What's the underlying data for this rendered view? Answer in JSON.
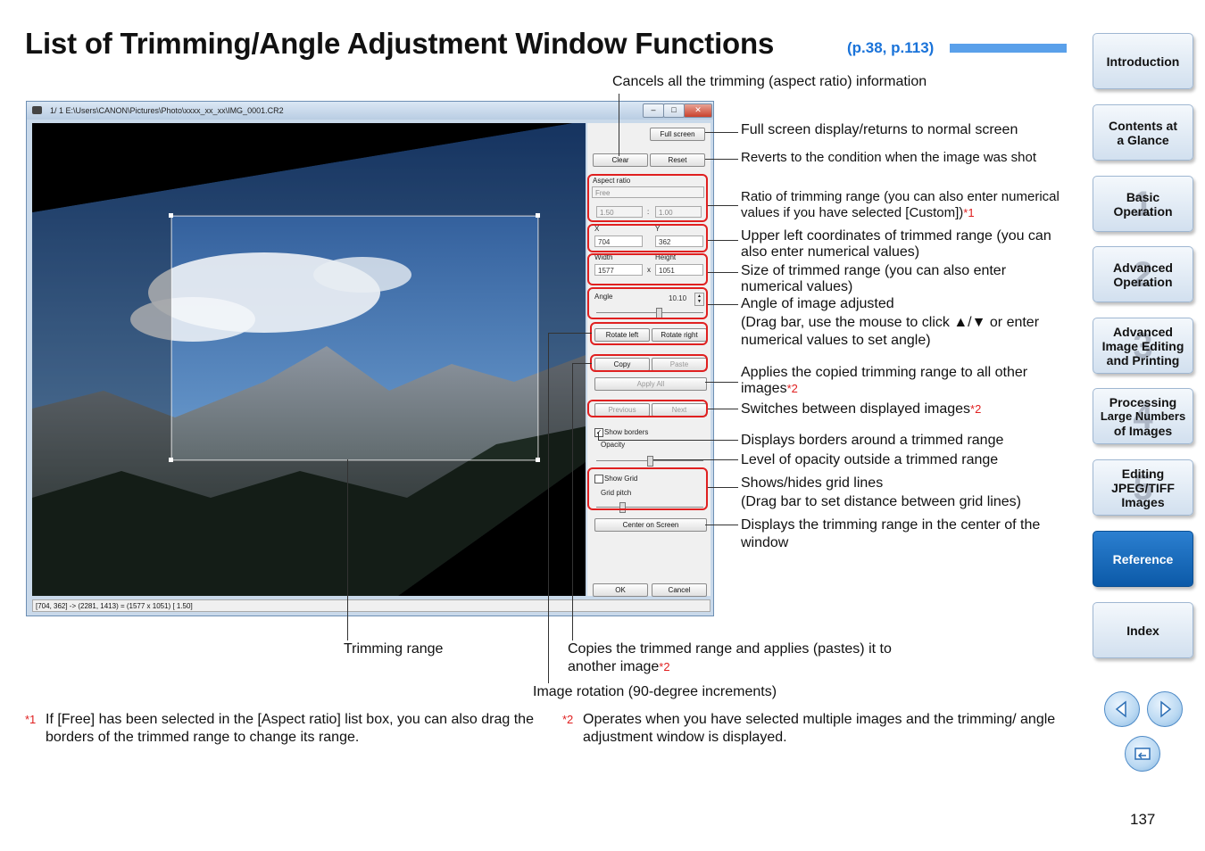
{
  "title": "List of Trimming/Angle Adjustment Window Functions",
  "title_ref": "(p.38, p.113)",
  "window": {
    "titlebar": "1/ 1  E:\\Users\\CANON\\Pictures\\Photo\\xxxx_xx_xx\\IMG_0001.CR2",
    "buttons": {
      "full_screen": "Full screen",
      "clear": "Clear",
      "reset": "Reset",
      "rotate_left": "Rotate left",
      "rotate_right": "Rotate right",
      "copy": "Copy",
      "paste": "Paste",
      "apply_all": "Apply All",
      "previous": "Previous",
      "next": "Next",
      "center_on_screen": "Center on Screen",
      "ok": "OK",
      "cancel": "Cancel"
    },
    "aspect_ratio_label": "Aspect ratio",
    "aspect_ratio_value": "Free",
    "ratio_a": "1.50",
    "ratio_sep": ":",
    "ratio_b": "1.00",
    "x_label": "X",
    "x_value": "704",
    "y_label": "Y",
    "y_value": "362",
    "width_label": "Width",
    "width_value": "1577",
    "times": "x",
    "height_label": "Height",
    "height_value": "1051",
    "angle_label": "Angle",
    "angle_value": "10.10",
    "show_borders": "Show borders",
    "opacity_label": "Opacity",
    "show_grid": "Show Grid",
    "grid_pitch": "Grid pitch",
    "status": "[704,  362] -> (2281, 1413) = (1577 x 1051) [ 1.50]"
  },
  "callouts": {
    "cancels": "Cancels all the trimming (aspect ratio) information",
    "full_screen": "Full screen display/returns to normal screen",
    "reverts": "Reverts to the condition when the image was shot",
    "ratio": "Ratio of trimming range (you can also enter numerical values if you have selected [Custom])",
    "ratio_mark": "*1",
    "upper_left": "Upper left coordinates of trimmed range (you can also enter numerical values)",
    "size": "Size of trimmed range (you can also enter numerical values)",
    "angle": "Angle of image adjusted",
    "angle_sub": "(Drag bar, use the mouse to click ▲/▼ or enter numerical values to set angle)",
    "applies": "Applies the copied trimming range to all other images",
    "applies_mark": "*2",
    "switches": "Switches between displayed images",
    "switches_mark": "*2",
    "borders": "Displays borders around a trimmed range",
    "opacity": "Level of opacity outside a trimmed range",
    "grid": "Shows/hides grid lines",
    "grid_sub": "(Drag bar to set distance between grid lines)",
    "center": "Displays the trimming range in the center of the window",
    "trimming_range": "Trimming range",
    "copies": "Copies the trimmed range and applies (pastes) it to another image",
    "copies_mark": "*2",
    "rotation": "Image rotation (90-degree increments)"
  },
  "footnotes": [
    {
      "mark": "*1",
      "text": "If [Free] has been selected in the [Aspect ratio] list box, you can also drag the borders of the trimmed range to change its range."
    },
    {
      "mark": "*2",
      "text": "Operates when you have selected multiple images and the trimming/ angle adjustment window is displayed."
    }
  ],
  "nav": {
    "introduction": "Introduction",
    "contents_1": "Contents at",
    "contents_2": "a Glance",
    "basic_1": "Basic",
    "basic_2": "Operation",
    "basic_num": "1",
    "adv_1": "Advanced",
    "adv_2": "Operation",
    "adv_num": "2",
    "adv_img_1": "Advanced",
    "adv_img_2": "Image Editing",
    "adv_img_3": "and Printing",
    "adv_img_num": "3",
    "proc_1": "Processing",
    "proc_2": "Large Numbers",
    "proc_3": "of Images",
    "proc_num": "4",
    "edit_1": "Editing",
    "edit_2": "JPEG/TIFF",
    "edit_3": "Images",
    "edit_num": "5",
    "reference": "Reference",
    "index": "Index"
  },
  "page_number": "137",
  "colors": {
    "accent": "#1a73d9",
    "mark": "#e02020",
    "nav_active": "#0c5aa8"
  }
}
